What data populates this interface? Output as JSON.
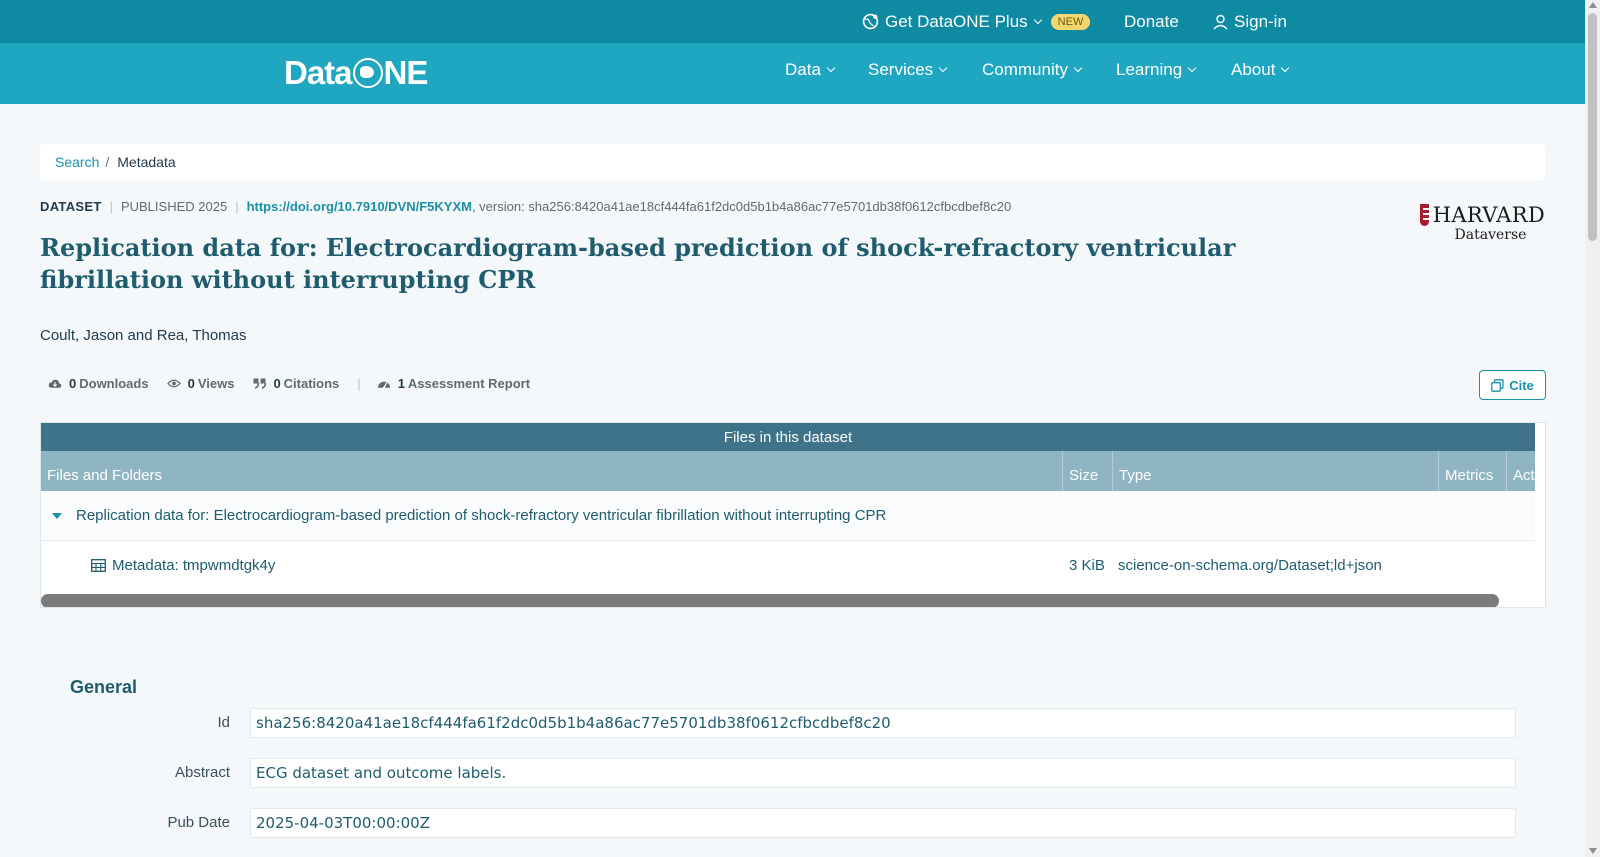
{
  "topbar": {
    "plus_label": "Get DataONE Plus",
    "new_badge": "NEW",
    "donate": "Donate",
    "signin": "Sign-in"
  },
  "brand": {
    "logo_left": "Data",
    "logo_right": "NE"
  },
  "nav": {
    "items": [
      {
        "label": "Data"
      },
      {
        "label": "Services"
      },
      {
        "label": "Community"
      },
      {
        "label": "Learning"
      },
      {
        "label": "About"
      }
    ]
  },
  "breadcrumb": {
    "search": "Search",
    "sep": "/",
    "current": "Metadata"
  },
  "dataset": {
    "type": "DATASET",
    "published": "PUBLISHED 2025",
    "doi": "https://doi.org/10.7910/DVN/F5KYXM",
    "version": ", version: sha256:8420a41ae18cf444fa61f2dc0d5b1b4a86ac77e5701db38f0612cfbcdbef8c20",
    "title": "Replication data for: Electrocardiogram-based prediction of shock-refractory ventricular fibrillation without interrupting CPR",
    "authors": "Coult, Jason and Rea, Thomas",
    "repository_name": "HARVARD",
    "repository_sub": "Dataverse"
  },
  "metrics": {
    "downloads_count": "0",
    "downloads_label": "Downloads",
    "views_count": "0",
    "views_label": "Views",
    "citations_count": "0",
    "citations_label": "Citations",
    "assessment_count": "1",
    "assessment_label": "Assessment Report",
    "cite_label": "Cite"
  },
  "files": {
    "caption": "Files in this dataset",
    "headers": [
      "Files and Folders",
      "Size",
      "Type",
      "Metrics",
      "Act"
    ],
    "package_name": "Replication data for: Electrocardiogram-based prediction of shock-refractory ventricular fibrillation without interrupting CPR",
    "rows": [
      {
        "name": "Metadata: tmpwmdtgk4y",
        "size": "3 KiB",
        "type": "science-on-schema.org/Dataset;ld+json"
      }
    ]
  },
  "general": {
    "heading": "General",
    "fields": [
      {
        "label": "Id",
        "value": "sha256:8420a41ae18cf444fa61f2dc0d5b1b4a86ac77e5701db38f0612cfbcdbef8c20"
      },
      {
        "label": "Abstract",
        "value": "ECG dataset and outcome labels."
      },
      {
        "label": "Pub Date",
        "value": "2025-04-03T00:00:00Z"
      }
    ]
  },
  "colors": {
    "topbar": "#0e8aa3",
    "navbar": "#1fa6c1",
    "accent": "#1d8fa8",
    "table_caption": "#3f7389",
    "table_header": "#8fb4c2"
  }
}
